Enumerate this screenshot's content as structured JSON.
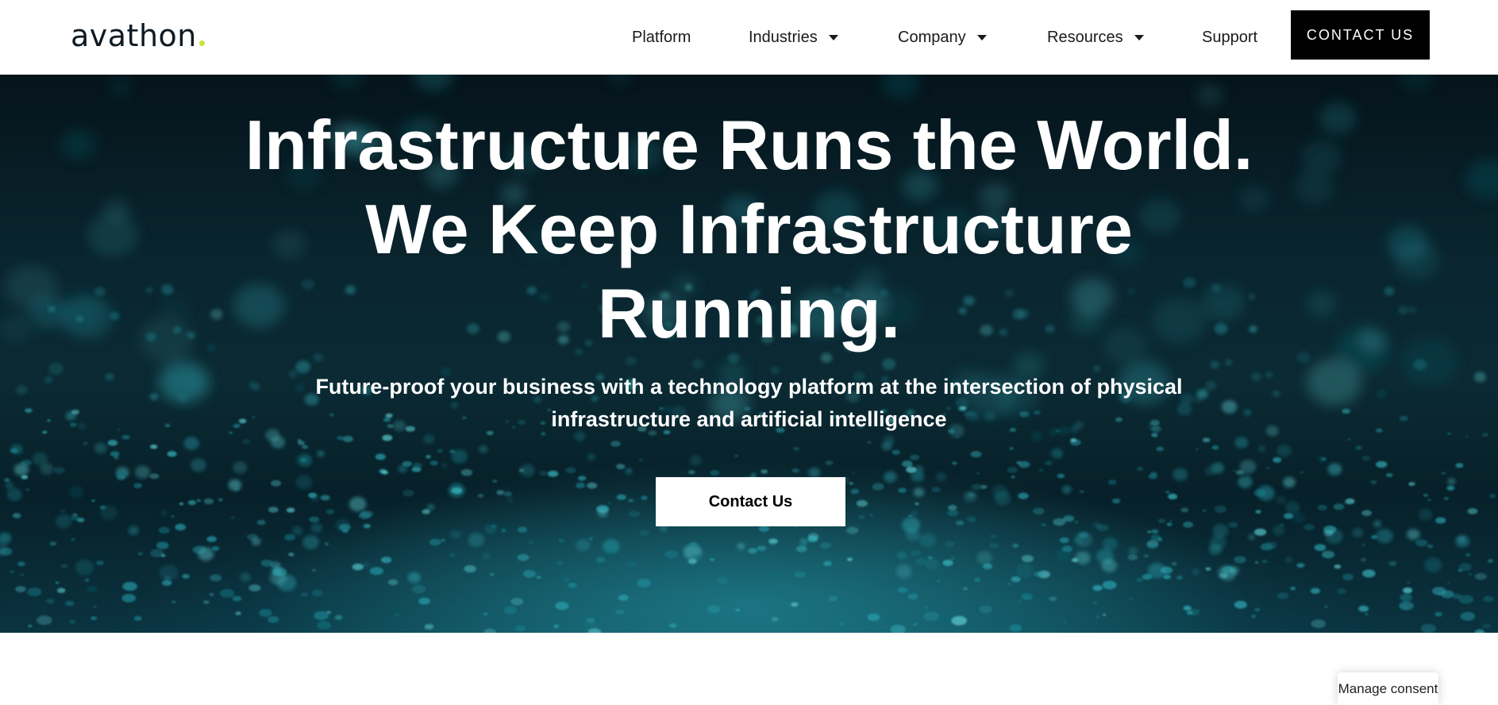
{
  "brand": {
    "name": "avathon",
    "accent_color": "#c6e23c"
  },
  "nav": {
    "items": [
      {
        "label": "Platform",
        "has_dropdown": false
      },
      {
        "label": "Industries",
        "has_dropdown": true
      },
      {
        "label": "Company",
        "has_dropdown": true
      },
      {
        "label": "Resources",
        "has_dropdown": true
      },
      {
        "label": "Support",
        "has_dropdown": false
      }
    ],
    "cta_label": "CONTACT US"
  },
  "hero": {
    "title_lines": [
      "Infrastructure Runs the World.",
      "We Keep Infrastructure",
      "Running."
    ],
    "subtitle_lines": [
      "Future-proof your business with a technology platform at the intersection of physical",
      "infrastructure and artificial intelligence"
    ],
    "button_label": "Contact Us"
  },
  "consent": {
    "label": "Manage consent"
  }
}
